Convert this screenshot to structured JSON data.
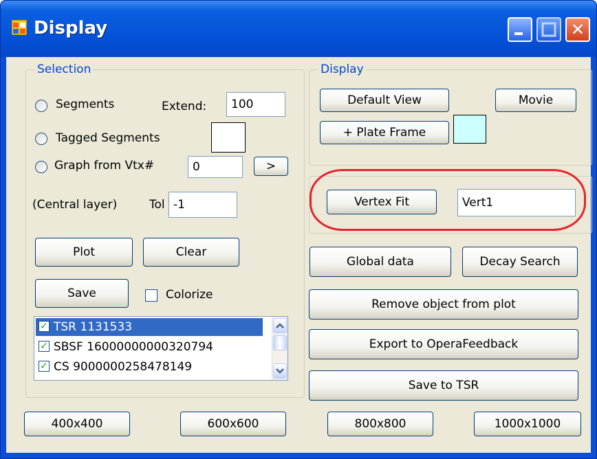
{
  "window": {
    "title": "Display",
    "icon": "app-window-icon"
  },
  "caption_buttons": {
    "minimize_icon": "minimize-icon",
    "maximize_icon": "maximize-icon",
    "close_icon": "close-icon",
    "close_glyph": "✕"
  },
  "selection": {
    "group_label": "Selection",
    "segments_label": "Segments",
    "extend_label": "Extend:",
    "extend_value": "100",
    "tagged_segments_label": "Tagged Segments",
    "graph_from_vtx_label": "Graph from Vtx#",
    "vtx_value": "0",
    "next_button": ">",
    "central_layer_label": "(Central layer)",
    "tol_label": "Tol",
    "tol_value": "-1",
    "plot_button": "Plot",
    "clear_button": "Clear",
    "save_button": "Save",
    "colorize_label": "Colorize",
    "colorize_checked": false,
    "list_items": [
      {
        "label": "TSR 1131533",
        "checked": true,
        "selected": true
      },
      {
        "label": "SBSF 16000000000320794",
        "checked": true,
        "selected": false
      },
      {
        "label": "CS 9000000258478149",
        "checked": true,
        "selected": false
      }
    ]
  },
  "display": {
    "group_label": "Display",
    "default_view_button": "Default View",
    "movie_button": "Movie",
    "plate_frame_button": "+ Plate Frame",
    "plate_frame_color": "#ccffff"
  },
  "vertex": {
    "fit_button": "Vertex Fit",
    "name_value": "Vert1"
  },
  "actions": {
    "global_data_button": "Global data",
    "decay_search_button": "Decay Search",
    "remove_object_button": "Remove object from plot",
    "export_button": "Export to OperaFeedback",
    "save_tsr_button": "Save to TSR"
  },
  "sizes": [
    "400x400",
    "600x600",
    "800x800",
    "1000x1000"
  ],
  "colors": {
    "titlebar": "#0553da",
    "client": "#ece9d8",
    "group_label": "#0046d5",
    "annotation": "#e8232b",
    "selection_highlight": "#316ac5"
  }
}
